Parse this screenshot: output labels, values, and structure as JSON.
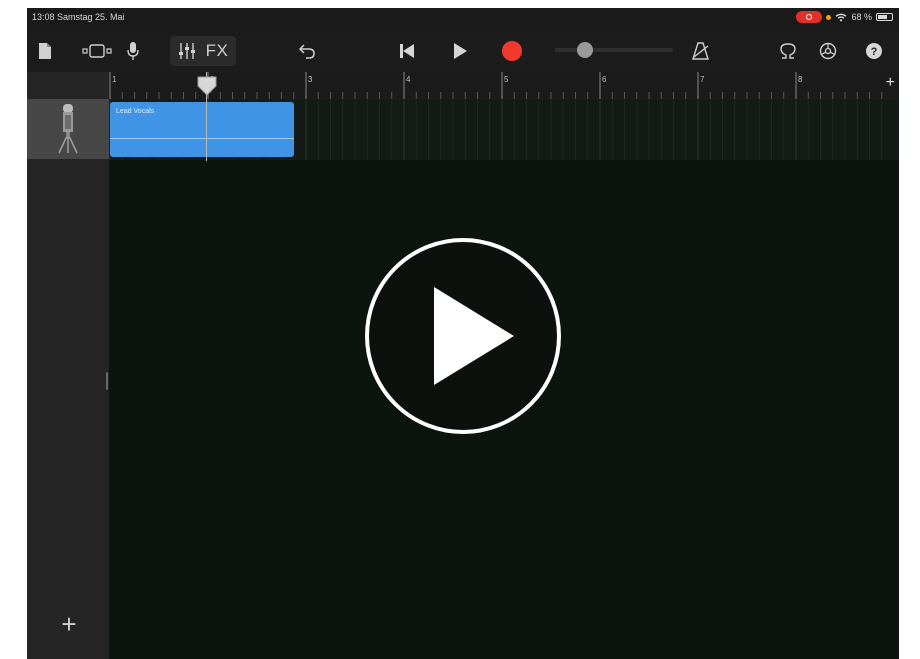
{
  "status": {
    "time_date": "13:08  Samstag 25. Mai",
    "battery": "68 %",
    "battery_level": 0.68,
    "recording_indicator_color": "#e0302a"
  },
  "toolbar": {
    "fx_label": "FX",
    "record_color": "#f03a2e",
    "volume_level": 0.22,
    "icons": [
      "document-icon",
      "tracks-view-icon",
      "microphone-icon",
      "mixer-icon",
      "fx-button",
      "undo-icon",
      "go-to-start-icon",
      "play-icon",
      "record-icon",
      "metronome-icon",
      "loop-browser-icon",
      "settings-icon",
      "help-icon"
    ]
  },
  "ruler": {
    "bars": [
      "1",
      "2",
      "3",
      "4",
      "5",
      "6",
      "7",
      "8"
    ],
    "add_label": "+"
  },
  "track": {
    "name": "Lead Vocals",
    "instrument_icon": "microphone-icon",
    "region_color": "#3f94e6"
  },
  "sidebar": {
    "add_label": "+"
  },
  "overlay": {
    "icon": "play-overlay-icon"
  }
}
